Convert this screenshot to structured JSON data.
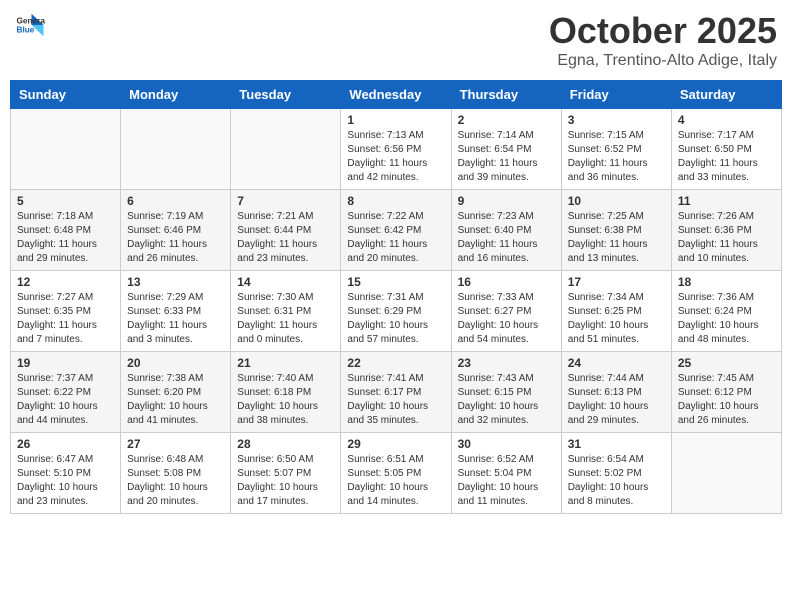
{
  "header": {
    "logo_general": "General",
    "logo_blue": "Blue",
    "month_title": "October 2025",
    "location": "Egna, Trentino-Alto Adige, Italy"
  },
  "days_of_week": [
    "Sunday",
    "Monday",
    "Tuesday",
    "Wednesday",
    "Thursday",
    "Friday",
    "Saturday"
  ],
  "weeks": [
    [
      {
        "day": "",
        "info": ""
      },
      {
        "day": "",
        "info": ""
      },
      {
        "day": "",
        "info": ""
      },
      {
        "day": "1",
        "info": "Sunrise: 7:13 AM\nSunset: 6:56 PM\nDaylight: 11 hours and 42 minutes."
      },
      {
        "day": "2",
        "info": "Sunrise: 7:14 AM\nSunset: 6:54 PM\nDaylight: 11 hours and 39 minutes."
      },
      {
        "day": "3",
        "info": "Sunrise: 7:15 AM\nSunset: 6:52 PM\nDaylight: 11 hours and 36 minutes."
      },
      {
        "day": "4",
        "info": "Sunrise: 7:17 AM\nSunset: 6:50 PM\nDaylight: 11 hours and 33 minutes."
      }
    ],
    [
      {
        "day": "5",
        "info": "Sunrise: 7:18 AM\nSunset: 6:48 PM\nDaylight: 11 hours and 29 minutes."
      },
      {
        "day": "6",
        "info": "Sunrise: 7:19 AM\nSunset: 6:46 PM\nDaylight: 11 hours and 26 minutes."
      },
      {
        "day": "7",
        "info": "Sunrise: 7:21 AM\nSunset: 6:44 PM\nDaylight: 11 hours and 23 minutes."
      },
      {
        "day": "8",
        "info": "Sunrise: 7:22 AM\nSunset: 6:42 PM\nDaylight: 11 hours and 20 minutes."
      },
      {
        "day": "9",
        "info": "Sunrise: 7:23 AM\nSunset: 6:40 PM\nDaylight: 11 hours and 16 minutes."
      },
      {
        "day": "10",
        "info": "Sunrise: 7:25 AM\nSunset: 6:38 PM\nDaylight: 11 hours and 13 minutes."
      },
      {
        "day": "11",
        "info": "Sunrise: 7:26 AM\nSunset: 6:36 PM\nDaylight: 11 hours and 10 minutes."
      }
    ],
    [
      {
        "day": "12",
        "info": "Sunrise: 7:27 AM\nSunset: 6:35 PM\nDaylight: 11 hours and 7 minutes."
      },
      {
        "day": "13",
        "info": "Sunrise: 7:29 AM\nSunset: 6:33 PM\nDaylight: 11 hours and 3 minutes."
      },
      {
        "day": "14",
        "info": "Sunrise: 7:30 AM\nSunset: 6:31 PM\nDaylight: 11 hours and 0 minutes."
      },
      {
        "day": "15",
        "info": "Sunrise: 7:31 AM\nSunset: 6:29 PM\nDaylight: 10 hours and 57 minutes."
      },
      {
        "day": "16",
        "info": "Sunrise: 7:33 AM\nSunset: 6:27 PM\nDaylight: 10 hours and 54 minutes."
      },
      {
        "day": "17",
        "info": "Sunrise: 7:34 AM\nSunset: 6:25 PM\nDaylight: 10 hours and 51 minutes."
      },
      {
        "day": "18",
        "info": "Sunrise: 7:36 AM\nSunset: 6:24 PM\nDaylight: 10 hours and 48 minutes."
      }
    ],
    [
      {
        "day": "19",
        "info": "Sunrise: 7:37 AM\nSunset: 6:22 PM\nDaylight: 10 hours and 44 minutes."
      },
      {
        "day": "20",
        "info": "Sunrise: 7:38 AM\nSunset: 6:20 PM\nDaylight: 10 hours and 41 minutes."
      },
      {
        "day": "21",
        "info": "Sunrise: 7:40 AM\nSunset: 6:18 PM\nDaylight: 10 hours and 38 minutes."
      },
      {
        "day": "22",
        "info": "Sunrise: 7:41 AM\nSunset: 6:17 PM\nDaylight: 10 hours and 35 minutes."
      },
      {
        "day": "23",
        "info": "Sunrise: 7:43 AM\nSunset: 6:15 PM\nDaylight: 10 hours and 32 minutes."
      },
      {
        "day": "24",
        "info": "Sunrise: 7:44 AM\nSunset: 6:13 PM\nDaylight: 10 hours and 29 minutes."
      },
      {
        "day": "25",
        "info": "Sunrise: 7:45 AM\nSunset: 6:12 PM\nDaylight: 10 hours and 26 minutes."
      }
    ],
    [
      {
        "day": "26",
        "info": "Sunrise: 6:47 AM\nSunset: 5:10 PM\nDaylight: 10 hours and 23 minutes."
      },
      {
        "day": "27",
        "info": "Sunrise: 6:48 AM\nSunset: 5:08 PM\nDaylight: 10 hours and 20 minutes."
      },
      {
        "day": "28",
        "info": "Sunrise: 6:50 AM\nSunset: 5:07 PM\nDaylight: 10 hours and 17 minutes."
      },
      {
        "day": "29",
        "info": "Sunrise: 6:51 AM\nSunset: 5:05 PM\nDaylight: 10 hours and 14 minutes."
      },
      {
        "day": "30",
        "info": "Sunrise: 6:52 AM\nSunset: 5:04 PM\nDaylight: 10 hours and 11 minutes."
      },
      {
        "day": "31",
        "info": "Sunrise: 6:54 AM\nSunset: 5:02 PM\nDaylight: 10 hours and 8 minutes."
      },
      {
        "day": "",
        "info": ""
      }
    ]
  ]
}
